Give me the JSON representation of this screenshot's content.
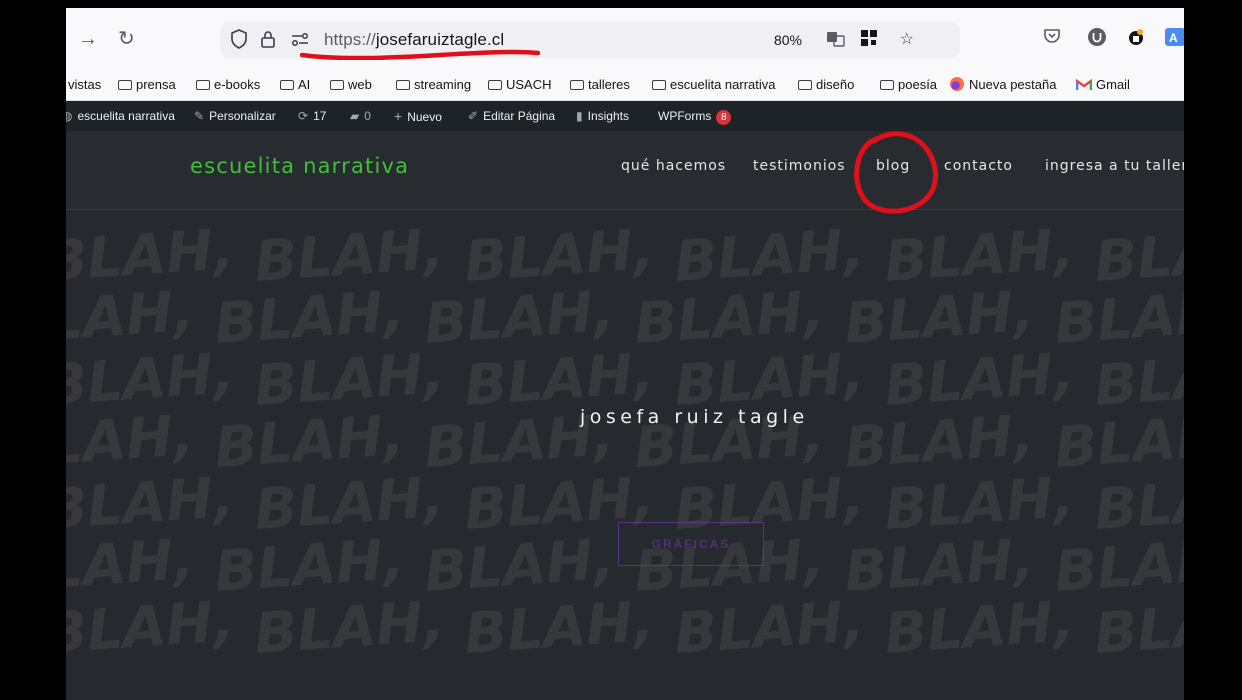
{
  "browser": {
    "url_protocol": "https://",
    "url_host": "josefaruiztagle.cl",
    "zoom": "80%"
  },
  "bookmarks": [
    {
      "label": "vistas",
      "folder": false
    },
    {
      "label": "prensa",
      "folder": true
    },
    {
      "label": "e-books",
      "folder": true
    },
    {
      "label": "AI",
      "folder": true
    },
    {
      "label": "web",
      "folder": true
    },
    {
      "label": "streaming",
      "folder": true
    },
    {
      "label": "USACH",
      "folder": true
    },
    {
      "label": "talleres",
      "folder": true
    },
    {
      "label": "escuelita narrativa",
      "folder": true
    },
    {
      "label": "diseño",
      "folder": true
    },
    {
      "label": "poesía",
      "folder": true
    },
    {
      "label": "Nueva pestaña",
      "folder": false
    },
    {
      "label": "Gmail",
      "folder": false
    }
  ],
  "adminbar": {
    "site": "escuelita narrativa",
    "customize": "Personalizar",
    "updates": "17",
    "comments": "0",
    "new": "Nuevo",
    "edit": "Editar Página",
    "insights": "Insights",
    "wpforms": "WPForms",
    "wpforms_count": "8"
  },
  "site": {
    "title": "escuelita narrativa",
    "menu": [
      "qué hacemos",
      "testimonios",
      "blog",
      "contacto",
      "ingresa a tu taller"
    ],
    "hero_title": "josefa ruiz tagle",
    "hero_button": "GRÁFICAS",
    "background_word": "BLAH,"
  },
  "colors": {
    "site_title": "#3fbf3a",
    "annotation": "#e0101a",
    "badge": "#d63638"
  }
}
